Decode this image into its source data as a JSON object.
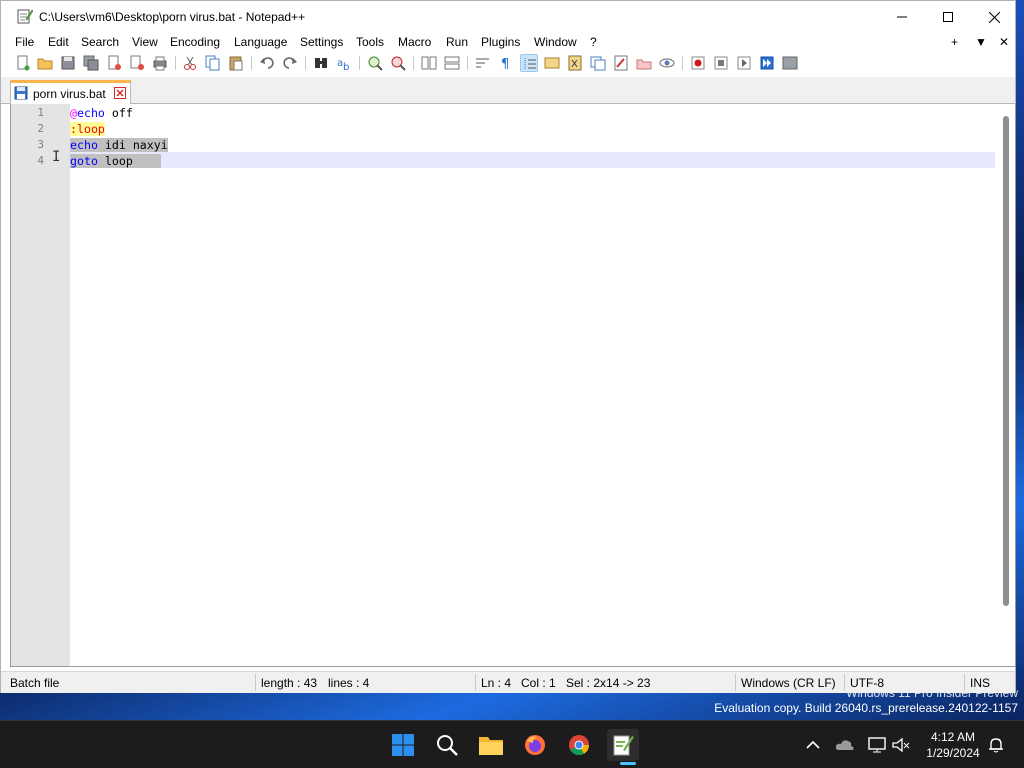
{
  "window": {
    "title": "C:\\Users\\vm6\\Desktop\\porn virus.bat - Notepad++"
  },
  "menu": {
    "items": [
      "File",
      "Edit",
      "Search",
      "View",
      "Encoding",
      "Language",
      "Settings",
      "Tools",
      "Macro",
      "Run",
      "Plugins",
      "Window",
      "?"
    ],
    "right": [
      "+",
      "▼",
      "✕"
    ]
  },
  "tabs": [
    {
      "label": "porn virus.bat",
      "active": true
    }
  ],
  "editor": {
    "line_numbers": [
      "1",
      "2",
      "3",
      "4"
    ],
    "lines": [
      {
        "prefix": "@",
        "keyword": "echo",
        "rest": " off"
      },
      {
        "label": ":loop"
      },
      {
        "keyword": "echo",
        "rest": " idi naxyi"
      },
      {
        "keyword": "goto",
        "rest": " loop"
      }
    ],
    "current_line": 4
  },
  "status": {
    "language": "Batch file",
    "length": "length : 43",
    "lines": "lines : 4",
    "ln": "Ln : 4",
    "col": "Col : 1",
    "sel": "Sel : 2x14 -> 23",
    "eol": "Windows (CR LF)",
    "encoding": "UTF-8",
    "mode": "INS"
  },
  "watermark": {
    "line1": "Windows 11 Pro Insider Preview",
    "line2": "Evaluation copy. Build 26040.rs_prerelease.240122-1157"
  },
  "taskbar": {
    "apps": [
      "start-icon",
      "search-icon",
      "file-explorer-icon",
      "firefox-icon",
      "chrome-icon",
      "notepadpp-icon"
    ],
    "active_app": "notepadpp-icon",
    "clock": {
      "time": "4:12 AM",
      "date": "1/29/2024"
    }
  },
  "colors": {
    "keyword": "#0000ff",
    "label_text": "#ff0000",
    "label_bg": "#fefc94",
    "at_sign": "#ff00ff",
    "selection": "#c0c0c0",
    "tab_accent": "#fab44b"
  }
}
